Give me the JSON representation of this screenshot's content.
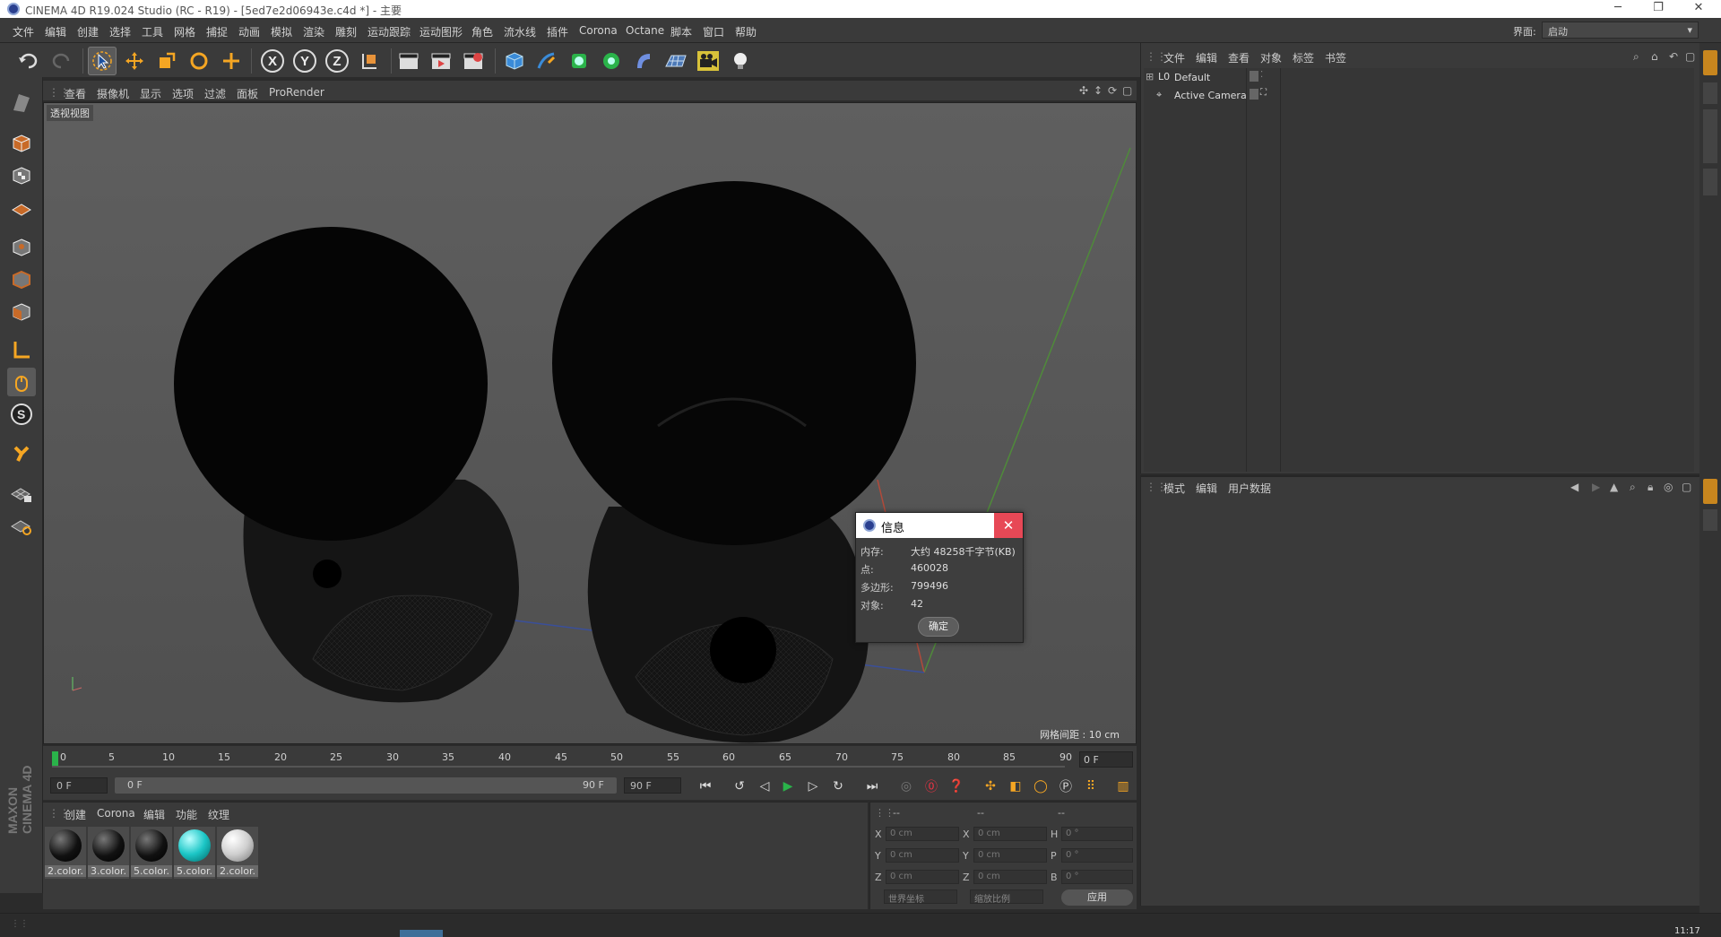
{
  "window": {
    "title": "CINEMA 4D R19.024 Studio (RC - R19) - [5ed7e2d06943e.c4d *] - 主要",
    "minimize": "─",
    "restore": "❐",
    "close": "✕"
  },
  "menu": [
    "文件",
    "编辑",
    "创建",
    "选择",
    "工具",
    "网格",
    "捕捉",
    "动画",
    "模拟",
    "渲染",
    "雕刻",
    "运动跟踪",
    "运动图形",
    "角色",
    "流水线",
    "插件",
    "Corona",
    "Octane",
    "脚本",
    "窗口",
    "帮助"
  ],
  "layout": {
    "label": "界面:",
    "value": "启动"
  },
  "viewport": {
    "menu": [
      "查看",
      "摄像机",
      "显示",
      "选项",
      "过滤",
      "面板",
      "ProRender"
    ],
    "label": "透视视图",
    "grid_spacing": "网格间距 : 10 cm"
  },
  "timeline": {
    "ticks": [
      "0",
      "5",
      "10",
      "15",
      "20",
      "25",
      "30",
      "35",
      "40",
      "45",
      "50",
      "55",
      "60",
      "65",
      "70",
      "75",
      "80",
      "85",
      "90"
    ],
    "current_frame": "0 F",
    "start_field": "0 F",
    "range_start": "0 F",
    "range_end": "90 F",
    "end_field": "90 F"
  },
  "materials": {
    "menu": [
      "创建",
      "Corona",
      "编辑",
      "功能",
      "纹理"
    ],
    "items": [
      {
        "label": "2.color.",
        "color": "#111111"
      },
      {
        "label": "3.color.",
        "color": "#111111"
      },
      {
        "label": "5.color.",
        "color": "#111111"
      },
      {
        "label": "5.color.",
        "color": "#1cc6c6"
      },
      {
        "label": "2.color.",
        "color": "#cfcfcf"
      }
    ]
  },
  "coords": {
    "headers": [
      "--",
      "--",
      "--"
    ],
    "rows": [
      {
        "a": "X",
        "av": "0 cm",
        "b": "X",
        "bv": "0 cm",
        "c": "H",
        "cv": "0 °"
      },
      {
        "a": "Y",
        "av": "0 cm",
        "b": "Y",
        "bv": "0 cm",
        "c": "P",
        "cv": "0 °"
      },
      {
        "a": "Z",
        "av": "0 cm",
        "b": "Z",
        "bv": "0 cm",
        "c": "B",
        "cv": "0 °"
      }
    ],
    "mode1": "世界坐标",
    "mode2": "缩放比例",
    "apply": "应用"
  },
  "object_manager": {
    "menu": [
      "文件",
      "编辑",
      "查看",
      "对象",
      "标签",
      "书签"
    ],
    "objects": [
      "Default",
      "Active Camera"
    ]
  },
  "attribute_manager": {
    "menu": [
      "模式",
      "编辑",
      "用户数据"
    ]
  },
  "dialog": {
    "title": "信息",
    "rows": [
      {
        "k": "内存:",
        "v": "大约 48258千字节(KB)"
      },
      {
        "k": "点:",
        "v": "460028"
      },
      {
        "k": "多边形:",
        "v": "799496"
      },
      {
        "k": "对象:",
        "v": "42"
      }
    ],
    "ok": "确定"
  },
  "branding": {
    "line1": "MAXON",
    "line2": "CINEMA 4D"
  },
  "status": {
    "clock": "11:17"
  }
}
